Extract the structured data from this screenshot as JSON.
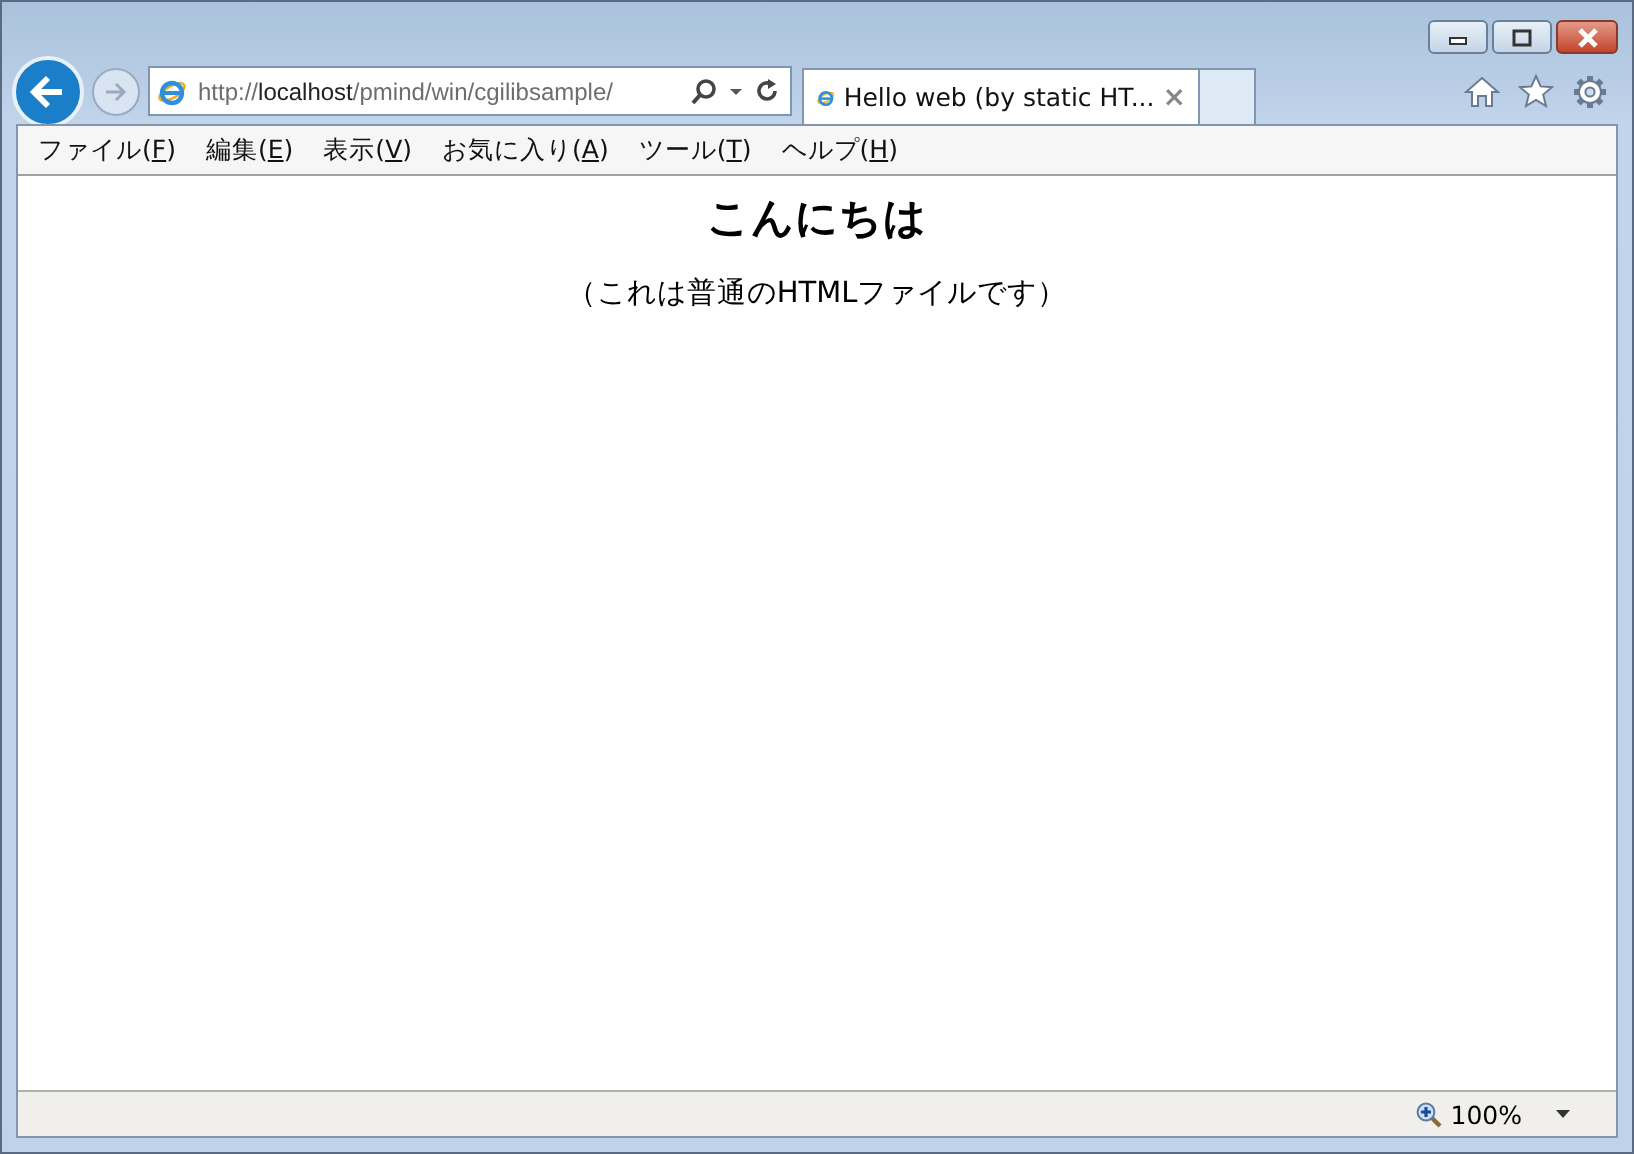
{
  "window": {
    "controls": [
      {
        "kind": "minimize"
      },
      {
        "kind": "maximize"
      },
      {
        "kind": "close"
      }
    ]
  },
  "address_bar": {
    "scheme": "http://",
    "host": "localhost",
    "path": "/pmind/win/cgilibsample/"
  },
  "tabs": [
    {
      "title": "Hello web (by static HT...",
      "close": "×",
      "selected": true
    }
  ],
  "menu": [
    {
      "prefix": "ファイル(",
      "key": "F",
      "suffix": ")"
    },
    {
      "prefix": "編集(",
      "key": "E",
      "suffix": ")"
    },
    {
      "prefix": "表示(",
      "key": "V",
      "suffix": ")"
    },
    {
      "prefix": "お気に入り(",
      "key": "A",
      "suffix": ")"
    },
    {
      "prefix": "ツール(",
      "key": "T",
      "suffix": ")"
    },
    {
      "prefix": "ヘルプ(",
      "key": "H",
      "suffix": ")"
    }
  ],
  "page": {
    "heading": "こんにちは",
    "text": "（これは普通のHTMLファイルです）"
  },
  "status_bar": {
    "zoom": "100%"
  }
}
